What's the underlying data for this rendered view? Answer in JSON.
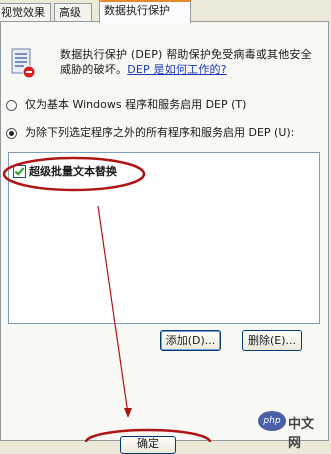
{
  "tabs": [
    {
      "label": "视觉效果",
      "active": false
    },
    {
      "label": "高级",
      "active": false
    },
    {
      "label": "数据执行保护",
      "active": true
    }
  ],
  "description": {
    "text": "数据执行保护 (DEP) 帮助保护免受病毒或其他安全威胁的破坏。",
    "link": "DEP 是如何工作的?"
  },
  "options": {
    "essential_only": {
      "label": "仅为基本 Windows 程序和服务启用 DEP (T)",
      "selected": false
    },
    "all_except": {
      "label": "为除下列选定程序之外的所有程序和服务启用 DEP (U):",
      "selected": true
    }
  },
  "program_list": [
    {
      "label": "超级批量文本替换",
      "checked": true
    }
  ],
  "buttons": {
    "add": "添加(D)...",
    "remove": "删除(E)...",
    "bottom": "确定"
  },
  "watermark": {
    "badge": "php",
    "text": "中文网"
  },
  "colors": {
    "annotation": "#b01515",
    "panel": "#f8f8f4",
    "tab_highlight": "#e68b2c"
  }
}
